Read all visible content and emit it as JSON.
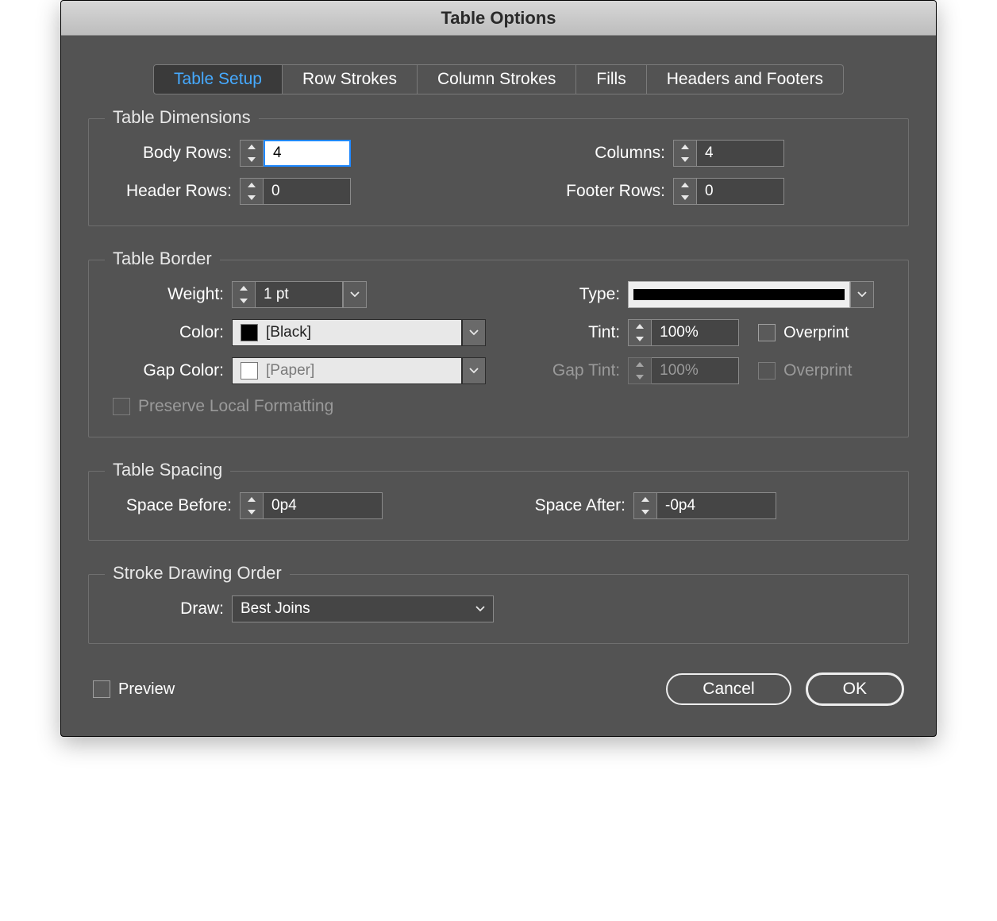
{
  "title": "Table Options",
  "tabs": [
    {
      "label": "Table Setup",
      "active": true
    },
    {
      "label": "Row Strokes",
      "active": false
    },
    {
      "label": "Column Strokes",
      "active": false
    },
    {
      "label": "Fills",
      "active": false
    },
    {
      "label": "Headers and Footers",
      "active": false
    }
  ],
  "dimensions": {
    "title": "Table Dimensions",
    "body_rows_label": "Body Rows:",
    "body_rows": "4",
    "columns_label": "Columns:",
    "columns": "4",
    "header_rows_label": "Header Rows:",
    "header_rows": "0",
    "footer_rows_label": "Footer Rows:",
    "footer_rows": "0"
  },
  "border": {
    "title": "Table Border",
    "weight_label": "Weight:",
    "weight": "1 pt",
    "type_label": "Type:",
    "type": "solid",
    "color_label": "Color:",
    "color_name": "[Black]",
    "color_hex": "#000000",
    "tint_label": "Tint:",
    "tint": "100%",
    "overprint_label": "Overprint",
    "overprint": false,
    "gap_color_label": "Gap Color:",
    "gap_color_name": "[Paper]",
    "gap_color_hex": "#ffffff",
    "gap_tint_label": "Gap Tint:",
    "gap_tint": "100%",
    "gap_overprint_label": "Overprint",
    "gap_overprint": false,
    "gap_overprint_enabled": false,
    "preserve_label": "Preserve Local Formatting",
    "preserve": false,
    "preserve_enabled": false
  },
  "spacing": {
    "title": "Table Spacing",
    "before_label": "Space Before:",
    "before": "0p4",
    "after_label": "Space After:",
    "after": "-0p4"
  },
  "drawing": {
    "title": "Stroke Drawing Order",
    "draw_label": "Draw:",
    "draw": "Best Joins"
  },
  "footer": {
    "preview_label": "Preview",
    "preview": false,
    "cancel": "Cancel",
    "ok": "OK"
  }
}
